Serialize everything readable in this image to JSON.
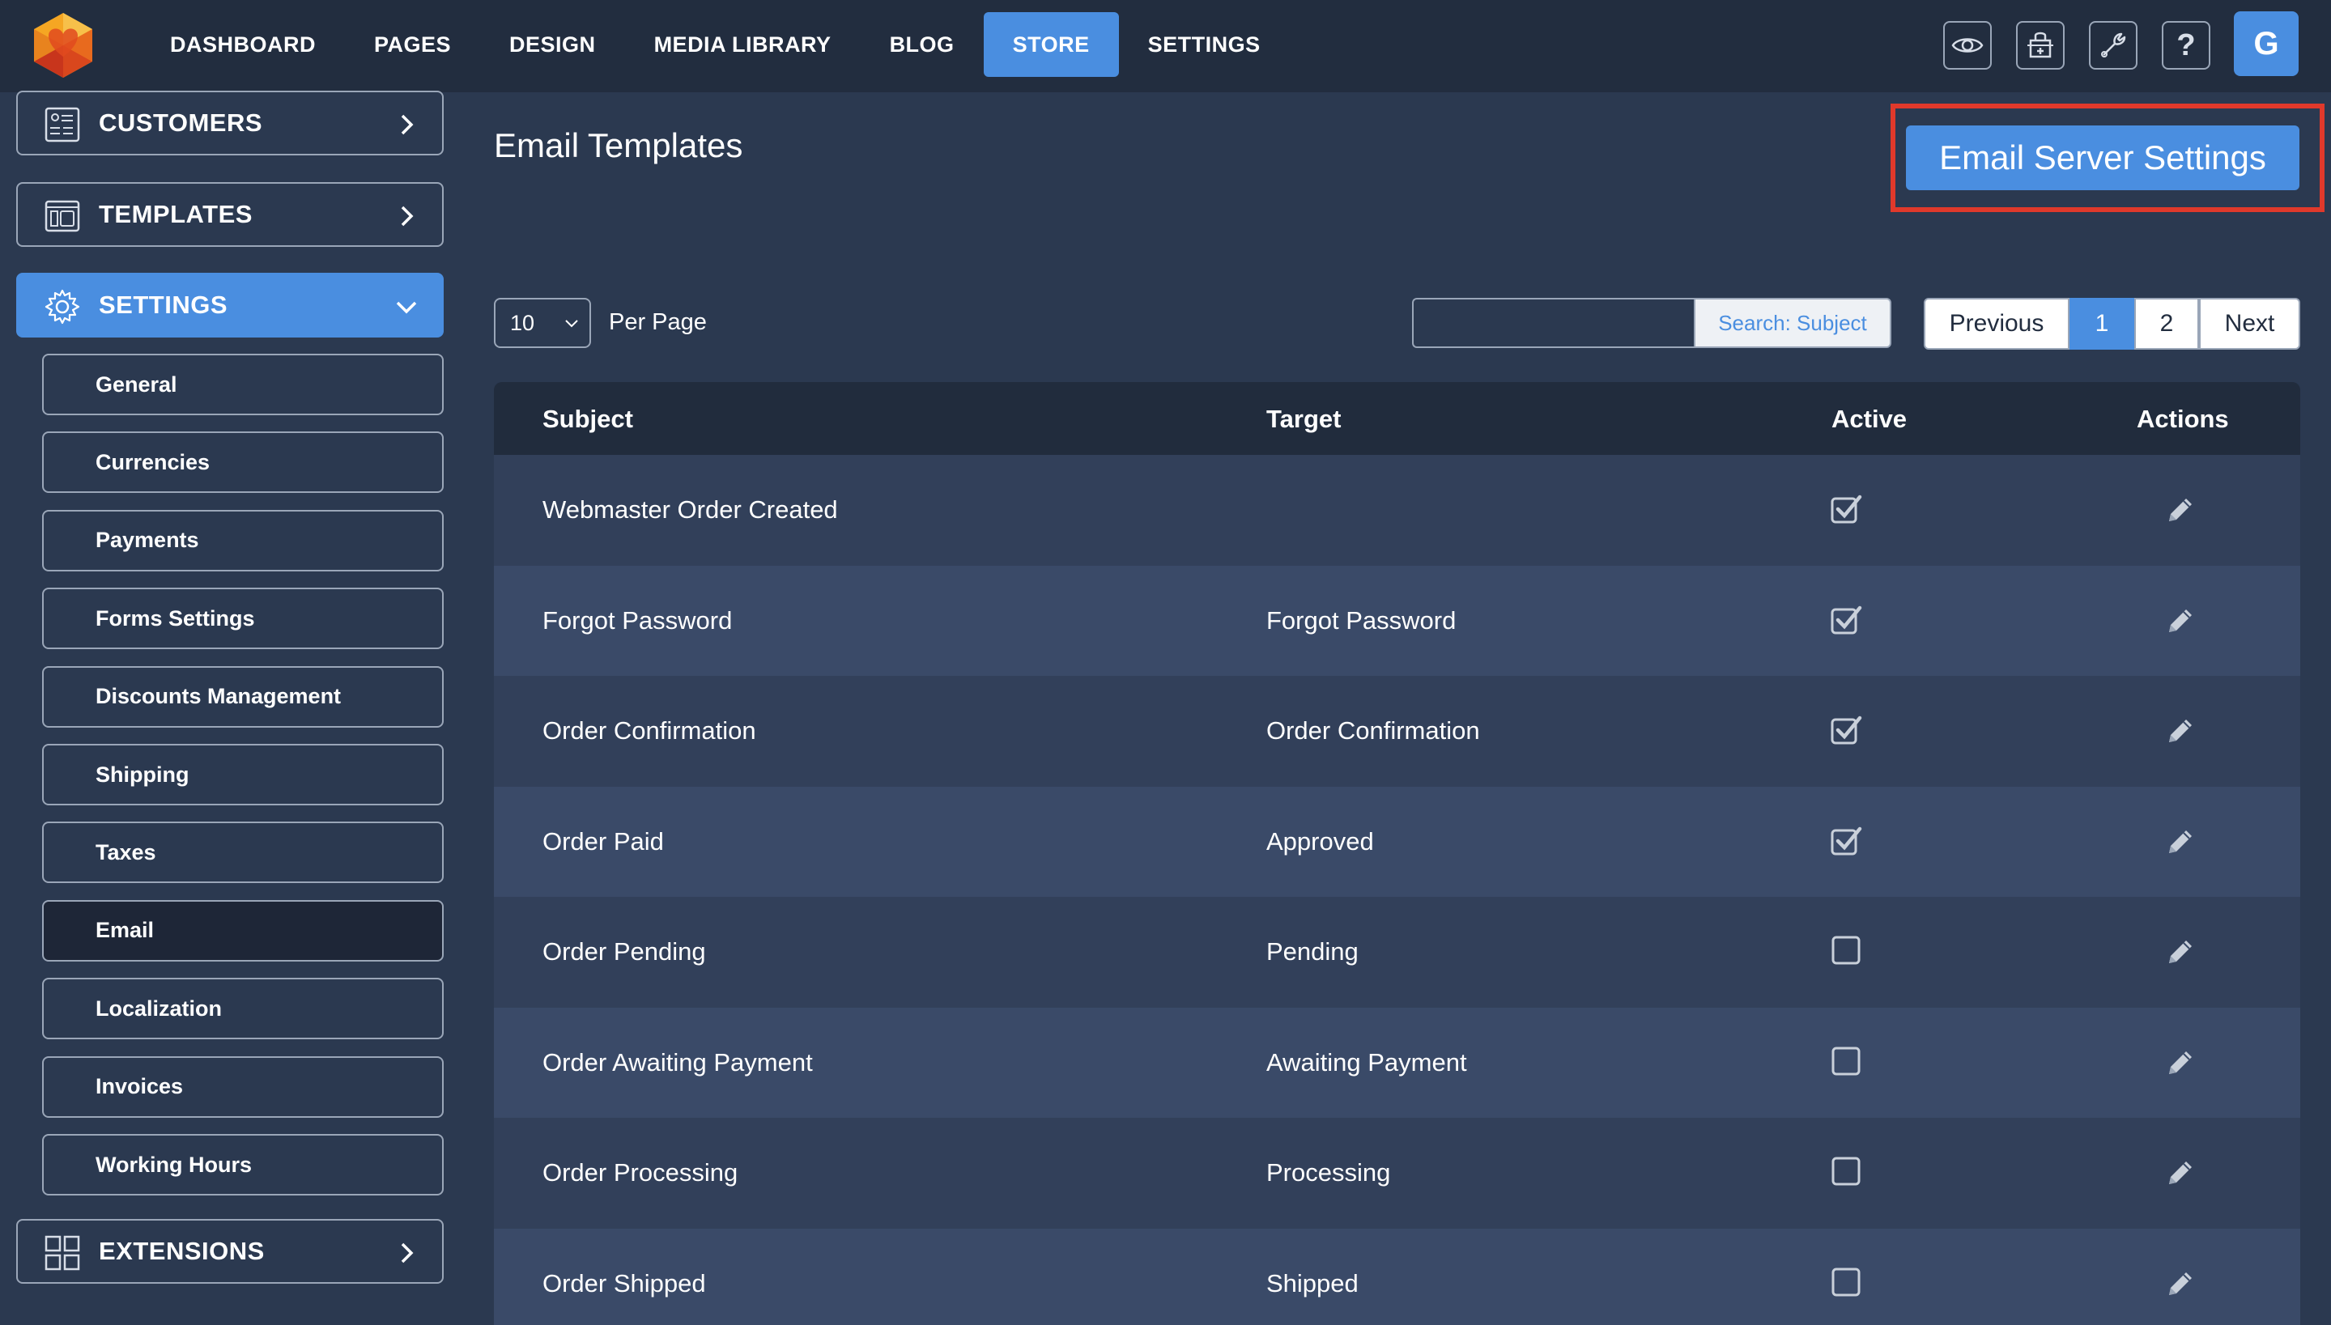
{
  "topbar": {
    "nav": [
      {
        "label": "DASHBOARD",
        "active": false
      },
      {
        "label": "PAGES",
        "active": false
      },
      {
        "label": "DESIGN",
        "active": false
      },
      {
        "label": "MEDIA LIBRARY",
        "active": false
      },
      {
        "label": "BLOG",
        "active": false
      },
      {
        "label": "STORE",
        "active": true
      },
      {
        "label": "SETTINGS",
        "active": false
      }
    ],
    "tools": [
      "eye-icon",
      "store-icon",
      "wrench-icon",
      "help-icon"
    ],
    "help_glyph": "?",
    "avatar_letter": "G"
  },
  "sidebar": {
    "customers": "CUSTOMERS",
    "templates": "TEMPLATES",
    "settings": "SETTINGS",
    "extensions": "EXTENSIONS",
    "settings_items": [
      {
        "label": "General"
      },
      {
        "label": "Currencies"
      },
      {
        "label": "Payments"
      },
      {
        "label": "Forms Settings"
      },
      {
        "label": "Discounts Management"
      },
      {
        "label": "Shipping"
      },
      {
        "label": "Taxes"
      },
      {
        "label": "Email",
        "current": true
      },
      {
        "label": "Localization"
      },
      {
        "label": "Invoices"
      },
      {
        "label": "Working Hours"
      }
    ]
  },
  "main": {
    "title": "Email Templates",
    "server_button": "Email Server Settings",
    "per_page_value": "10",
    "per_page_label": "Per Page",
    "search_value": "",
    "search_button": "Search: Subject",
    "pagination": {
      "previous": "Previous",
      "pages": [
        "1",
        "2"
      ],
      "current": "1",
      "next": "Next"
    },
    "columns": {
      "subject": "Subject",
      "target": "Target",
      "active": "Active",
      "actions": "Actions"
    },
    "rows": [
      {
        "subject": "Webmaster Order Created",
        "target": "",
        "active": true
      },
      {
        "subject": "Forgot Password",
        "target": "Forgot Password",
        "active": true
      },
      {
        "subject": "Order Confirmation",
        "target": "Order Confirmation",
        "active": true
      },
      {
        "subject": "Order Paid",
        "target": "Approved",
        "active": true
      },
      {
        "subject": "Order Pending",
        "target": "Pending",
        "active": false
      },
      {
        "subject": "Order Awaiting Payment",
        "target": "Awaiting Payment",
        "active": false
      },
      {
        "subject": "Order Processing",
        "target": "Processing",
        "active": false
      },
      {
        "subject": "Order Shipped",
        "target": "Shipped",
        "active": false
      }
    ]
  },
  "colors": {
    "accent": "#4a8ee0",
    "highlight": "#e0392b",
    "topbar": "#222d3f",
    "background": "#2b3950"
  }
}
